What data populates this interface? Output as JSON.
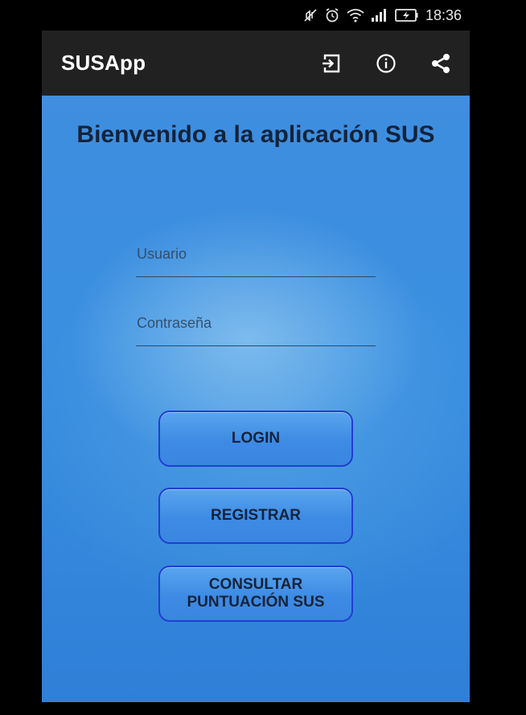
{
  "status_bar": {
    "time": "18:36",
    "icons": [
      "mute-icon",
      "alarm-icon",
      "wifi-icon",
      "signal-icon",
      "battery-charging-icon"
    ]
  },
  "toolbar": {
    "title": "SUSApp",
    "actions": [
      "logout-icon",
      "info-icon",
      "share-icon"
    ],
    "background": "#212121"
  },
  "content": {
    "welcome": "Bienvenido a la aplicación SUS",
    "username_placeholder": "Usuario",
    "password_placeholder": "Contraseña",
    "username_value": "",
    "password_value": "",
    "login_label": "LOGIN",
    "register_label": "REGISTRAR",
    "consult_label": "CONSULTAR\nPUNTUACIÓN SUS",
    "accent": "#1f3fd0",
    "background": "#3a8fe0"
  }
}
